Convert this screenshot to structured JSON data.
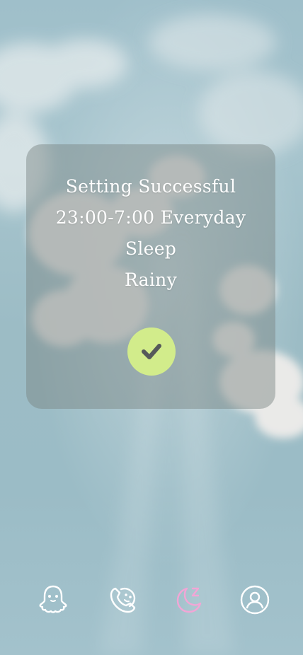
{
  "card": {
    "lines": [
      "Setting Successful",
      "23:00-7:00 Everyday",
      "Sleep",
      "Rainy"
    ],
    "accent_color": "#d2ec8b",
    "confirm_icon": "checkmark-icon"
  },
  "nav": {
    "items": [
      {
        "icon": "ghost-icon",
        "color": "#ffffff",
        "active": false
      },
      {
        "icon": "phone-face-icon",
        "color": "#ffffff",
        "active": false
      },
      {
        "icon": "moon-sleep-icon",
        "color": "#f2a6d6",
        "active": true
      },
      {
        "icon": "user-profile-icon",
        "color": "#ffffff",
        "active": false
      }
    ]
  }
}
